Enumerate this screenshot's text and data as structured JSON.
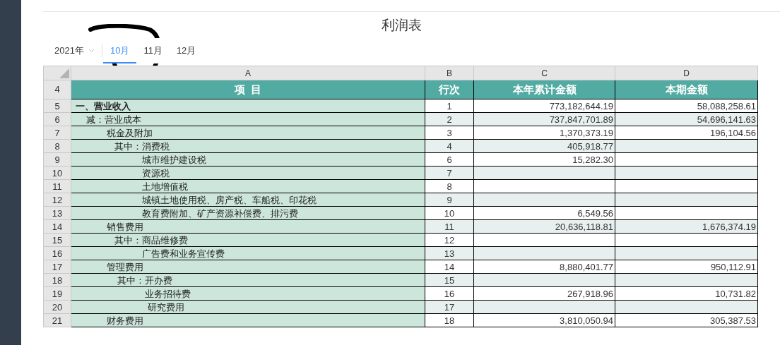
{
  "title": "利润表",
  "period": {
    "year": "2021年",
    "months": [
      {
        "label": "10月",
        "selected": true
      },
      {
        "label": "11月",
        "selected": false
      },
      {
        "label": "12月",
        "selected": false
      }
    ]
  },
  "sheet": {
    "columns": [
      "A",
      "B",
      "C",
      "D"
    ],
    "header_row": {
      "number": "4",
      "cells": [
        "项  目",
        "行次",
        "本年累计金额",
        "本期金额"
      ]
    },
    "rows": [
      {
        "number": "5",
        "kind": "heading",
        "item": "一、营业收入",
        "line": "1",
        "ytd": "773,182,644.19",
        "period": "58,088,258.61"
      },
      {
        "number": "6",
        "kind": "less",
        "item": "减：营业成本",
        "line": "2",
        "ytd": "737,847,701.89",
        "period": "54,696,141.63"
      },
      {
        "number": "7",
        "kind": "item",
        "item": "税金及附加",
        "line": "3",
        "ytd": "1,370,373.19",
        "period": "196,104.56"
      },
      {
        "number": "8",
        "kind": "of-which",
        "item": "其中：消费税",
        "line": "4",
        "ytd": "405,918.77"
      },
      {
        "number": "9",
        "kind": "detail",
        "item": "城市维护建设税",
        "line": "6",
        "ytd": "15,282.30"
      },
      {
        "number": "10",
        "kind": "detail",
        "item": "资源税",
        "line": "7"
      },
      {
        "number": "11",
        "kind": "detail",
        "item": "土地增值税",
        "line": "8"
      },
      {
        "number": "12",
        "kind": "detail",
        "item": "城镇土地使用税、房产税、车船税、印花税",
        "line": "9"
      },
      {
        "number": "13",
        "kind": "detail",
        "item": "教育费附加、矿产资源补偿费、排污费",
        "line": "10",
        "ytd": "6,549.56"
      },
      {
        "number": "14",
        "kind": "item",
        "item": "销售费用",
        "line": "11",
        "ytd": "20,636,118.81",
        "period": "1,676,374.19"
      },
      {
        "number": "15",
        "kind": "of-which",
        "item": "其中：商品维修费",
        "line": "12"
      },
      {
        "number": "16",
        "kind": "detail",
        "item": "广告费和业务宣传费",
        "line": "13"
      },
      {
        "number": "17",
        "kind": "item",
        "item": "管理费用",
        "line": "14",
        "ytd": "8,880,401.77",
        "period": "950,112.91"
      },
      {
        "number": "18",
        "kind": "of-which-2",
        "item": "其中：开办费",
        "line": "15"
      },
      {
        "number": "19",
        "kind": "detail-2",
        "item": "业务招待费",
        "line": "16",
        "ytd": "267,918.96",
        "period": "10,731.82"
      },
      {
        "number": "20",
        "kind": "detail-3",
        "item": "研究费用",
        "line": "17"
      },
      {
        "number": "21",
        "kind": "item",
        "item": "财务费用",
        "line": "18",
        "ytd": "3,810,050.94",
        "period": "305,387.53"
      }
    ]
  }
}
